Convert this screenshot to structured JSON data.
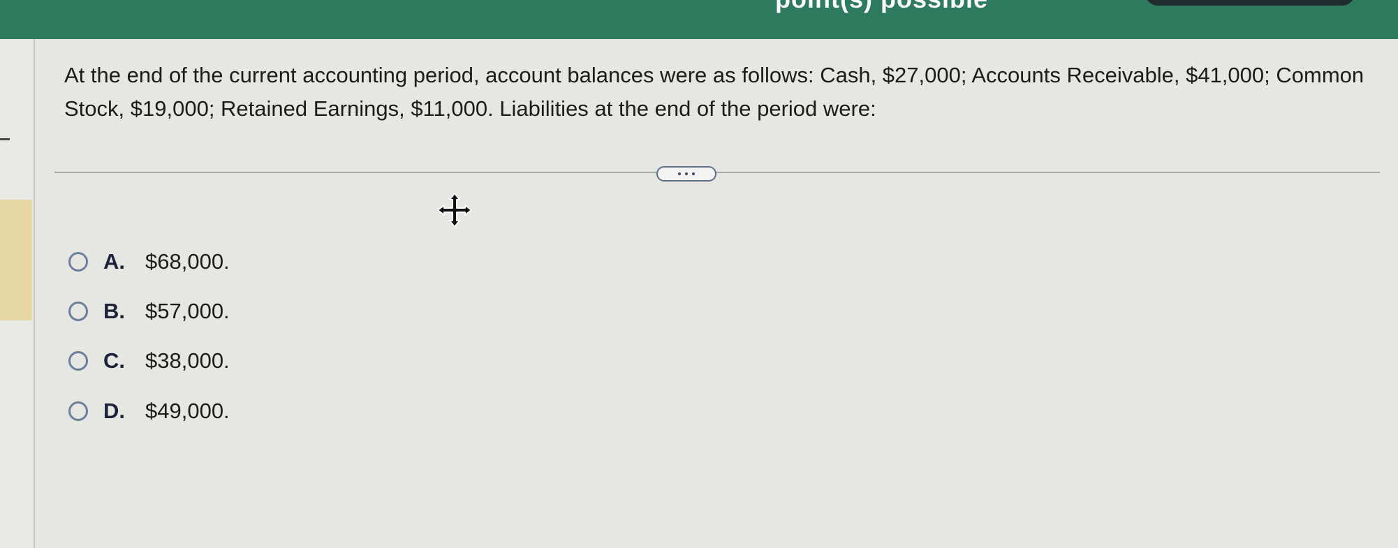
{
  "header": {
    "partial_text": "point(s) possible",
    "accent_color": "#2e7a5f"
  },
  "question": {
    "text": "At the end of the current accounting period, account balances were as follows: Cash, $27,000; Accounts Receivable, $41,000; Common Stock, $19,000; Retained Earnings, $11,000. Liabilities at the end of the period were:"
  },
  "more_button": {
    "icon": "ellipsis-icon"
  },
  "cursor": {
    "icon": "move-cursor-icon"
  },
  "options": [
    {
      "letter": "A.",
      "value": "$68,000."
    },
    {
      "letter": "B.",
      "value": "$57,000."
    },
    {
      "letter": "C.",
      "value": "$38,000."
    },
    {
      "letter": "D.",
      "value": "$49,000."
    }
  ]
}
